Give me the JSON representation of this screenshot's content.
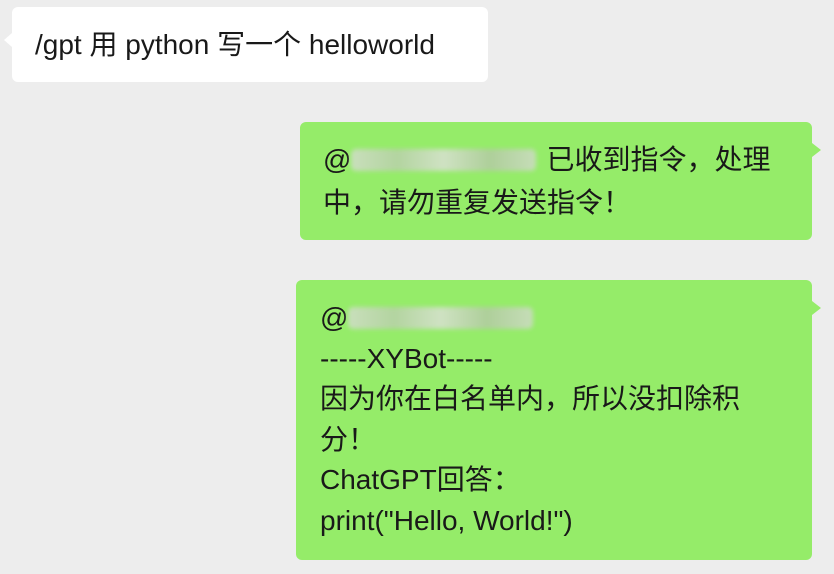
{
  "colors": {
    "background": "#ededed",
    "bubble_in": "#ffffff",
    "bubble_out": "#95ec69",
    "text": "#191919"
  },
  "chat": {
    "m1": {
      "text": "/gpt 用 python 写一个 helloworld"
    },
    "m2": {
      "at": "@",
      "line1": "已收到指令，处理",
      "line2": "中，请勿重复发送指令！"
    },
    "m3": {
      "at": "@",
      "lines": [
        "-----XYBot-----",
        "因为你在白名单内，所以没扣除积",
        "分！",
        "ChatGPT回答：",
        "print(\"Hello, World!\")"
      ]
    }
  }
}
